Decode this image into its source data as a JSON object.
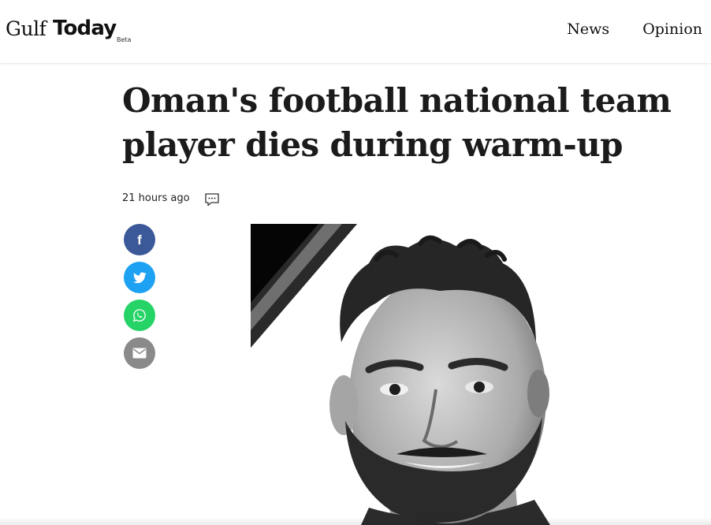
{
  "header": {
    "logo": {
      "part1": "Gulf",
      "part2": "Today",
      "badge": "Beta"
    },
    "nav": [
      {
        "label": "News"
      },
      {
        "label": "Opinion"
      }
    ]
  },
  "article": {
    "title": "Oman's football national team player dies during warm-up",
    "time_ago": "21 hours ago",
    "comment_icon": "comment-icon",
    "share": [
      {
        "network": "facebook",
        "icon": "facebook-icon",
        "color": "#3b5998"
      },
      {
        "network": "twitter",
        "icon": "twitter-icon",
        "color": "#1da1f2"
      },
      {
        "network": "whatsapp",
        "icon": "whatsapp-icon",
        "color": "#25d366"
      },
      {
        "network": "email",
        "icon": "email-icon",
        "color": "#8a8a8a"
      }
    ],
    "image": "black-and-white portrait of player with black mourning ribbon"
  }
}
